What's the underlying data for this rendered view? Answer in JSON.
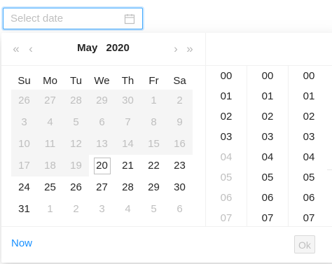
{
  "input": {
    "placeholder": "Select date"
  },
  "header": {
    "month": "May",
    "year": "2020"
  },
  "weekdays": [
    "Su",
    "Mo",
    "Tu",
    "We",
    "Th",
    "Fr",
    "Sa"
  ],
  "weeks": [
    [
      "26",
      "27",
      "28",
      "29",
      "30",
      "1",
      "2"
    ],
    [
      "3",
      "4",
      "5",
      "6",
      "7",
      "8",
      "9"
    ],
    [
      "10",
      "11",
      "12",
      "13",
      "14",
      "15",
      "16"
    ],
    [
      "17",
      "18",
      "19",
      "20",
      "21",
      "22",
      "23"
    ],
    [
      "24",
      "25",
      "26",
      "27",
      "28",
      "29",
      "30"
    ],
    [
      "31",
      "1",
      "2",
      "3",
      "4",
      "5",
      "6"
    ]
  ],
  "today": "20",
  "hours": [
    "00",
    "01",
    "02",
    "03",
    "04",
    "05",
    "06",
    "07"
  ],
  "minutes": [
    "00",
    "01",
    "02",
    "03",
    "04",
    "05",
    "06",
    "07"
  ],
  "seconds": [
    "00",
    "01",
    "02",
    "03",
    "04",
    "05",
    "06",
    "07"
  ],
  "footer": {
    "now_label": "Now",
    "ok_label": "Ok"
  },
  "colors": {
    "accent": "#1890ff",
    "disabled_text": "#bfbfbf",
    "disabled_bg": "#f5f5f5"
  },
  "icons": {
    "calendar": "calendar-icon",
    "super_prev": "double-chevron-left-icon",
    "prev": "chevron-left-icon",
    "next": "chevron-right-icon",
    "super_next": "double-chevron-right-icon"
  }
}
